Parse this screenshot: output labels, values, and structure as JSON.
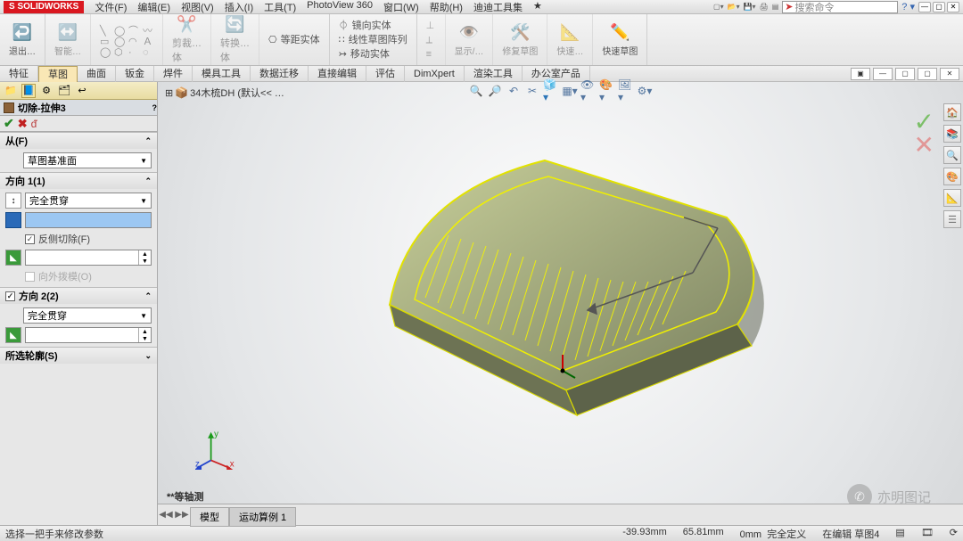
{
  "app": {
    "logo": "S SOLIDWORKS"
  },
  "menus": [
    "文件(F)",
    "编辑(E)",
    "视图(V)",
    "插入(I)",
    "工具(T)",
    "PhotoView 360",
    "窗口(W)",
    "帮助(H)",
    "迪迪工具集",
    "★"
  ],
  "search": {
    "placeholder": "搜索命令"
  },
  "ribbon": {
    "exit": "退出…",
    "smart": "智能…",
    "cut": {
      "lb": "剪裁…",
      "sub": "体"
    },
    "conv": {
      "lb": "转换…",
      "sub": "体"
    },
    "linePat": "等距实体",
    "mirror": "镜向实体",
    "linPat2": "线性草图阵列",
    "moveEnt": "移动实体",
    "show": "显示/…",
    "fix": "修复草图",
    "fast": "快速…",
    "fastSk": "快速草图"
  },
  "cmdTabs": [
    "特征",
    "草图",
    "曲面",
    "钣金",
    "焊件",
    "模具工具",
    "数据迁移",
    "直接编辑",
    "评估",
    "DimXpert",
    "渲染工具",
    "办公室产品"
  ],
  "activeTab": 1,
  "docName": "34木梳DH  (默认<< …",
  "feature": {
    "title": "切除-拉伸3",
    "from": {
      "head": "从(F)",
      "sel": "草图基准面"
    },
    "dir1": {
      "head": "方向 1(1)",
      "cond": "完全贯穿",
      "depth": "",
      "flip": "反侧切除(F)",
      "draftOut": "向外拨模(O)"
    },
    "dir2": {
      "head": "方向 2(2)",
      "cond": "完全贯穿"
    },
    "prof": {
      "head": "所选轮廓(S)"
    }
  },
  "viewLabel": "*等轴测",
  "triad": {
    "x": "x",
    "y": "y",
    "z": "z"
  },
  "sheetTabs": [
    "模型",
    "运动算例 1"
  ],
  "status": {
    "prompt": "选择一把手来修改参数",
    "x": "-39.93mm",
    "y": "65.81mm",
    "z": "0mm",
    "def": "完全定义",
    "edit": "在编辑 草图4"
  },
  "watermark": "亦明图记",
  "confirm": {
    "ok": "✓",
    "cancel": "✕"
  }
}
